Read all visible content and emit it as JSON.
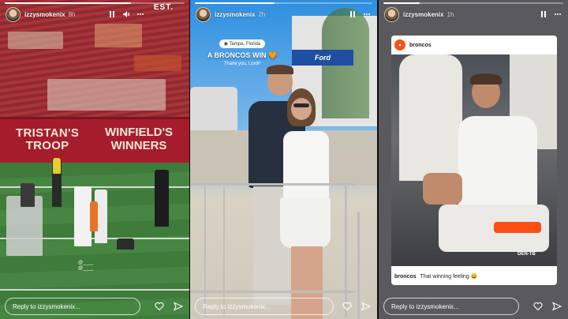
{
  "stories": [
    {
      "username": "izzysmokenix",
      "time": "8h",
      "progress": 0.7,
      "scoreboard_text": "EST.",
      "banner_left": [
        "TRISTAN'S",
        "TROOP"
      ],
      "banner_right": [
        "WINFIELD'S",
        "WINNERS"
      ],
      "mention_tags": [
        "@____",
        "@____"
      ],
      "reply_placeholder": "Reply to izzysmokenix...",
      "icons": [
        "pause-icon",
        "mute-icon",
        "more-icon",
        "heart-icon",
        "send-icon"
      ]
    },
    {
      "username": "izzysmokenix",
      "time": "2h",
      "progress": 0.45,
      "location_sticker": "Tampa, Florida",
      "caption": "A BRONCOS WIN 🧡",
      "caption_sub": "Thank you, Lord!!",
      "sign_text": "Ford",
      "reply_placeholder": "Reply to izzysmokenix...",
      "icons": [
        "pause-icon",
        "more-icon",
        "heart-icon",
        "send-icon"
      ]
    },
    {
      "username": "izzysmokenix",
      "time": "1h",
      "progress": 0.2,
      "shared_account": "broncos",
      "shared_caption_user": "broncos",
      "shared_caption_text": "That winning feeling 😀",
      "jersey_text": "DEN-TB",
      "reply_placeholder": "Reply to izzysmokenix...",
      "icons": [
        "pause-icon",
        "more-icon",
        "heart-icon",
        "send-icon"
      ]
    }
  ],
  "colors": {
    "stands_red": "#a8343a",
    "banner_red": "#a51d2d",
    "field_green": "#478642",
    "broncos_orange": "#fb4f14",
    "ford_blue": "#1f4fa0"
  }
}
